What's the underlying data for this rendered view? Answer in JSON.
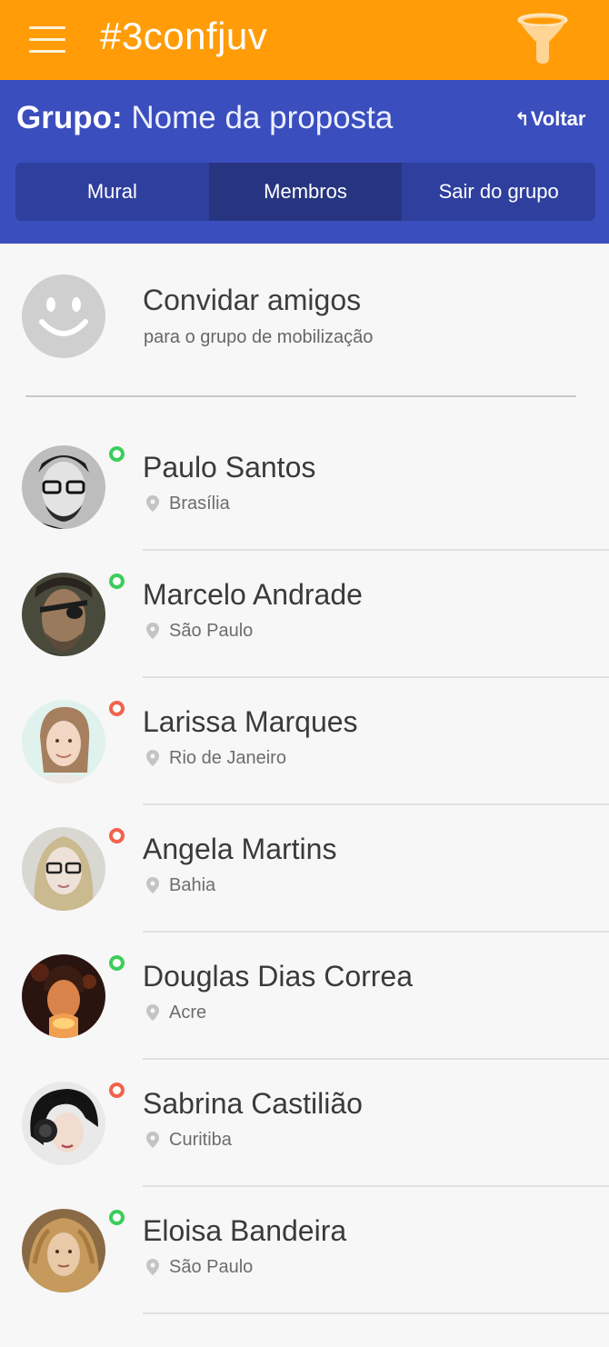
{
  "app": {
    "title": "#3confjuv"
  },
  "topbar": {
    "menu_icon": "hamburger-menu-icon",
    "filter_icon": "funnel-filter-icon"
  },
  "group": {
    "label": "Grupo:",
    "name": "Nome da proposta",
    "back_arrow": "↰",
    "back_label": "Voltar",
    "tabs": [
      {
        "label": "Mural",
        "active": false
      },
      {
        "label": "Membros",
        "active": true
      },
      {
        "label": "Sair do grupo",
        "active": false
      }
    ]
  },
  "invite": {
    "title": "Convidar amigos",
    "subtitle": "para o grupo de mobilização",
    "icon": "smiley-face-icon"
  },
  "members": [
    {
      "name": "Paulo Santos",
      "location": "Brasília",
      "status": "online"
    },
    {
      "name": "Marcelo Andrade",
      "location": "São Paulo",
      "status": "online"
    },
    {
      "name": "Larissa Marques",
      "location": "Rio de Janeiro",
      "status": "away"
    },
    {
      "name": "Angela Martins",
      "location": "Bahia",
      "status": "away"
    },
    {
      "name": "Douglas Dias Correa",
      "location": "Acre",
      "status": "online"
    },
    {
      "name": "Sabrina Castilião",
      "location": "Curitiba",
      "status": "away"
    },
    {
      "name": "Eloisa Bandeira",
      "location": "São Paulo",
      "status": "online"
    }
  ],
  "colors": {
    "topbar": "#ff9c07",
    "group_header": "#3a4ebd",
    "tabs_bg": "#2f3f9e",
    "tab_active": "#273580",
    "status_online": "#3ccd5a",
    "status_away": "#f2634d"
  }
}
